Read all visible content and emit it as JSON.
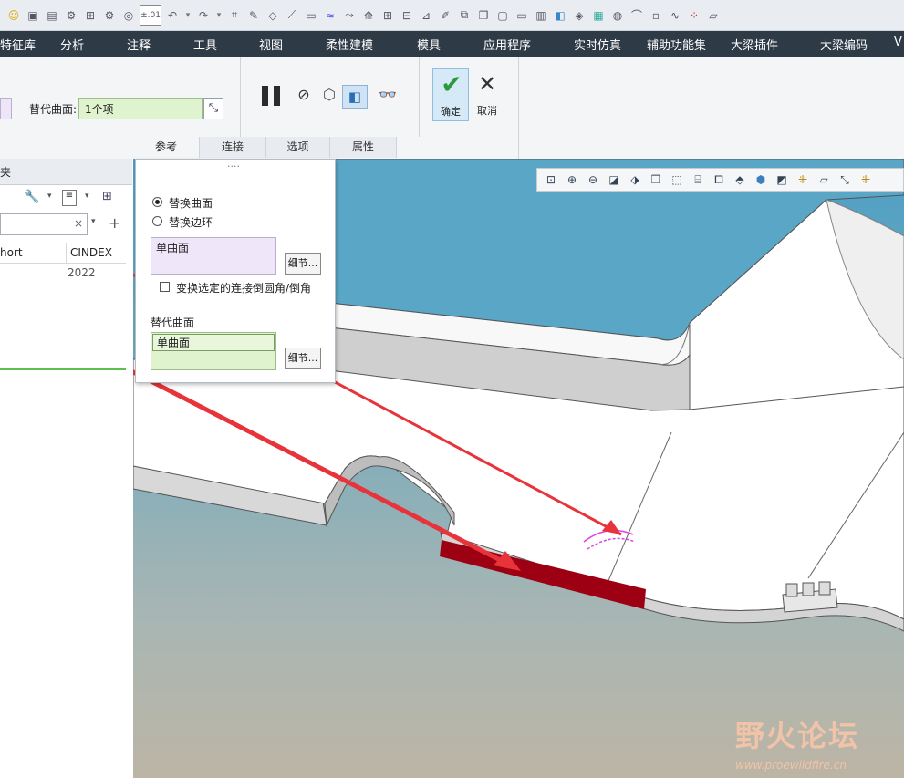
{
  "menu": {
    "items": [
      "特征库",
      "分析",
      "注释",
      "工具",
      "视图",
      "柔性建模",
      "模具",
      "应用程序",
      "实时仿真",
      "辅助功能集",
      "大梁插件",
      "大梁编码",
      "V"
    ]
  },
  "qat": {
    "tolerance_label": "±.01"
  },
  "ribbon": {
    "replacement_label": "替代曲面:",
    "replacement_value": "1个项",
    "ok_label": "确定",
    "cancel_label": "取消",
    "subtabs": [
      "参考",
      "连接",
      "选项",
      "属性"
    ]
  },
  "left_panel": {
    "header_fragment": "夹",
    "col_short": "hort",
    "col_cindex": "CINDEX",
    "value_cindex": "2022"
  },
  "ref_panel": {
    "grip": "....",
    "radio_replace_surface": "替换曲面",
    "radio_replace_loop": "替换边环",
    "selected_surface": "单曲面",
    "details_button": "细节...",
    "checkbox_label": "变换选定的连接倒圆角/倒角",
    "replacement_section_label": "替代曲面",
    "replacement_surface": "单曲面",
    "details_button2": "细节..."
  },
  "watermark": {
    "title": "野火论坛",
    "url": "www.proewildfire.cn"
  },
  "colors": {
    "menubar": "#2f3a47",
    "accent_green": "#dff3cf",
    "highlight_red": "#9c0012",
    "arrow_red": "#e8333a",
    "selected_purple": "#efe6f9"
  }
}
